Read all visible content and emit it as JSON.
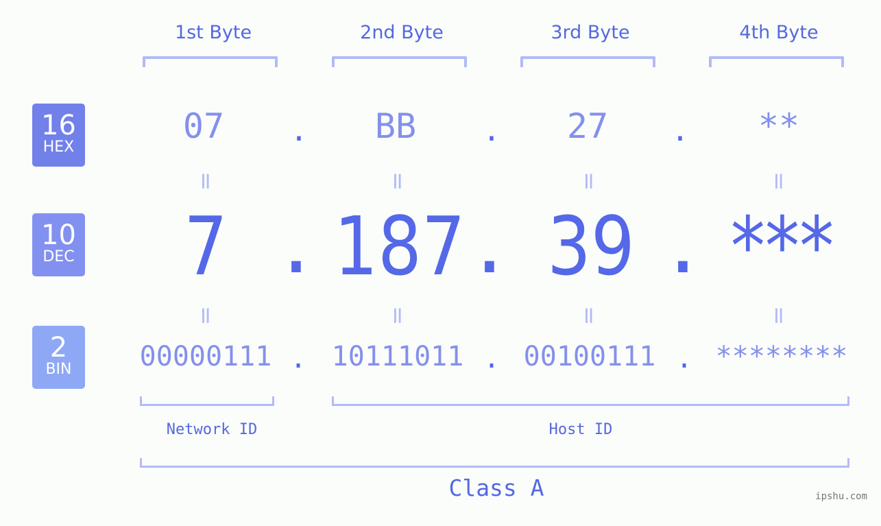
{
  "bases": [
    {
      "num": "16",
      "label": "HEX",
      "color": "#7280ea"
    },
    {
      "num": "10",
      "label": "DEC",
      "color": "#8291ef"
    },
    {
      "num": "2",
      "label": "BIN",
      "color": "#8ea8f5"
    }
  ],
  "headers": [
    "1st Byte",
    "2nd Byte",
    "3rd Byte",
    "4th Byte"
  ],
  "hex": [
    "07",
    "BB",
    "27",
    "**"
  ],
  "dec": [
    "7",
    "187",
    "39",
    "***"
  ],
  "bin": [
    "00000111",
    "10111011",
    "00100111",
    "********"
  ],
  "separator": ".",
  "equals": "||",
  "network_label": "Network ID",
  "host_label": "Host ID",
  "class_label": "Class A",
  "watermark": "ipshu.com",
  "colors": {
    "accent": "#5468e8",
    "light": "#8490ec",
    "bracket": "#b2bbf5"
  }
}
